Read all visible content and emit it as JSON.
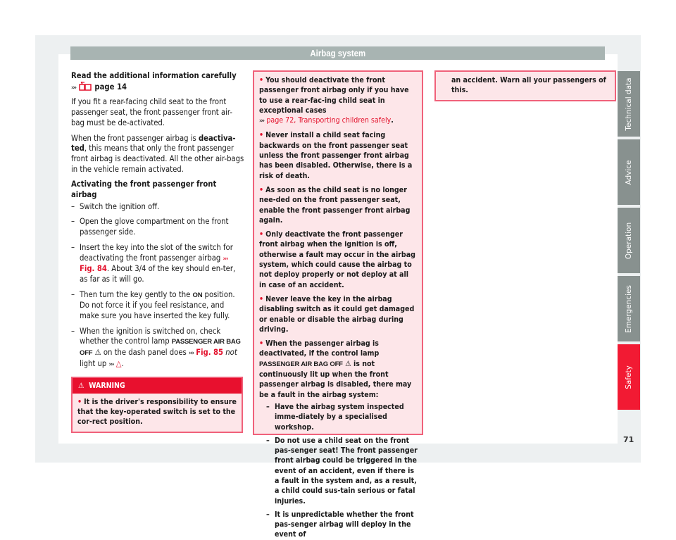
{
  "header": {
    "title": "Airbag system"
  },
  "column1": {
    "intro_bold": "Read the additional information carefully",
    "intro_ref": "page 14",
    "para1": "If you fit a rear-facing child seat to the front passenger seat, the front passenger front air-bag must be de-activated.",
    "para2_pre": "When the front passenger airbag is ",
    "para2_bold": "deactiva-ted",
    "para2_post": ", this means that only the front passenger front airbag is deactivated. All the other air-bags in the vehicle remain activated.",
    "section_title": "Activating the front passenger front airbag",
    "steps": {
      "s1": "Switch the ignition off.",
      "s2": "Open the glove compartment on the front passenger side.",
      "s3_pre": "Insert the key into the slot of the switch for deactivating the front passenger airbag ",
      "s3_ref": "Fig. 84",
      "s3_post": ". About 3/4 of the key should en-ter, as far as it will go.",
      "s4_pre": "Then turn the key gently to the ",
      "s4_bold": "ON",
      "s4_post": " position. Do not force it if you feel resistance, and make sure you have inserted the key fully.",
      "s5_pre": "When the ignition is switched on, check whether the control lamp ",
      "s5_lamp": "PASSENGER AIR BAG OFF",
      "s5_mid": " on the dash panel does ",
      "s5_ref": "Fig. 85",
      "s5_italic": "not",
      "s5_post": "light up"
    },
    "dash": "–",
    "chevrons": "›››"
  },
  "warning": {
    "title": "WARNING",
    "item1": "It is the driver's responsibility to ensure that the key-operated switch is set to the cor-rect position."
  },
  "box2": {
    "b1_pre": "You should deactivate the front passenger front airbag only if you have to use a rear-fac-ing child seat in exceptional cases",
    "b1_ref": "page 72, Transporting children safely",
    "b2": "Never install a child seat facing backwards on the front passenger seat unless the front passenger front airbag has been disabled. Otherwise, there is a risk of death.",
    "b3": "As soon as the child seat is no longer nee-ded on the front passenger seat, enable the front passenger front airbag again.",
    "b4": "Only deactivate the front passenger front airbag when the ignition is off, otherwise a fault may occur in the airbag system, which could cause the airbag to not deploy properly or not deploy at all in case of an accident.",
    "b5": "Never leave the key in the airbag disabling switch as it could get damaged or enable or disable the airbag during driving.",
    "b6_pre": "When the passenger airbag is deactivated, if the control lamp ",
    "b6_lamp": "PASSENGER AIR BAG OFF",
    "b6_post": " is not continuously lit up when the front passenger airbag is disabled, there may be a fault in the airbag system:",
    "sub1": "Have the airbag system inspected imme-diately by a specialised workshop.",
    "sub2": "Do not use a child seat on the front pas-senger seat! The front passenger front airbag could be triggered in the event of an accident, even if there is a fault in the system and, as a result, a child could sus-tain serious or fatal injuries.",
    "sub3": "It is unpredictable whether the front pas-senger airbag will deploy in the event of"
  },
  "box3": {
    "text": "an accident. Warn all your passengers of this."
  },
  "side_tabs": [
    {
      "label": "Technical data",
      "active": false
    },
    {
      "label": "Advice",
      "active": false
    },
    {
      "label": "Operation",
      "active": false
    },
    {
      "label": "Emergencies",
      "active": false
    },
    {
      "label": "Safety",
      "active": true
    }
  ],
  "page_number": "71",
  "colors": {
    "accent_red": "#e3102b",
    "tab_gray": "#88918f",
    "tab_active": "#f21a33",
    "warning_bg": "#fde6e9",
    "header_gray": "#a8b4b2"
  }
}
